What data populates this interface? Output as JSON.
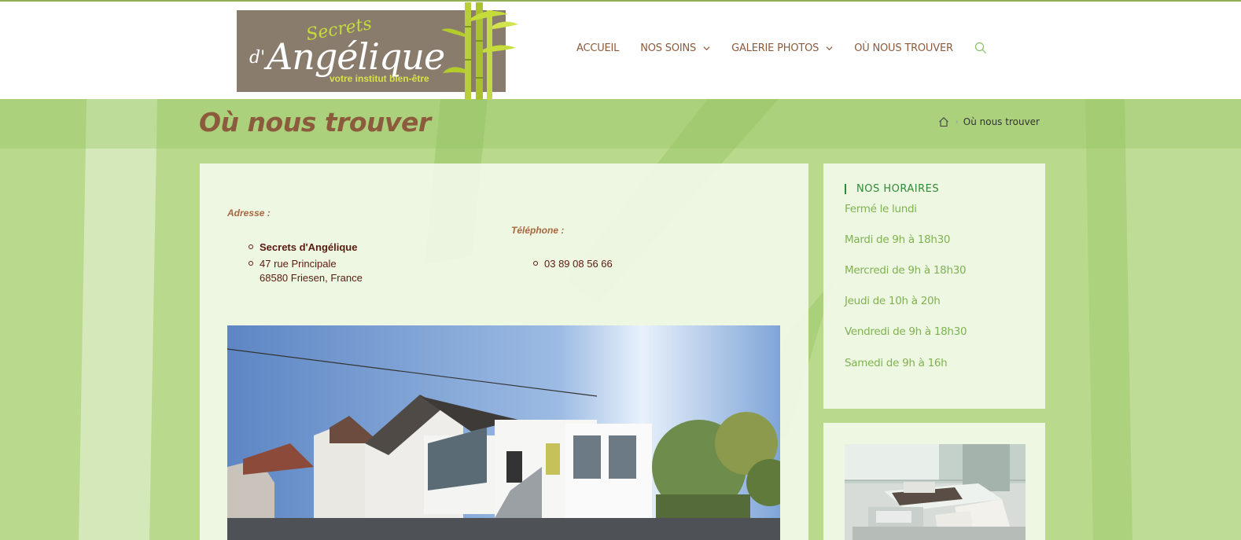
{
  "logo": {
    "line1": "Secrets",
    "line2_prefix": "d'",
    "line2": "Angélique",
    "tagline": "votre institut bien-être"
  },
  "nav": {
    "items": [
      {
        "label": "ACCUEIL",
        "has_dropdown": false
      },
      {
        "label": "NOS SOINS",
        "has_dropdown": true
      },
      {
        "label": "GALERIE PHOTOS",
        "has_dropdown": true
      },
      {
        "label": "OÙ NOUS TROUVER",
        "has_dropdown": false
      }
    ],
    "search_icon": "search-icon"
  },
  "page": {
    "title": "Où nous trouver",
    "breadcrumb": {
      "home_icon": "home-icon",
      "current": "Où nous trouver"
    }
  },
  "contact": {
    "address_label": "Adresse :",
    "address_lines": [
      "Secrets d'Angélique",
      "47 rue Principale",
      "68580 Friesen, France"
    ],
    "phone_label": "Téléphone :",
    "phone": "03 89 08 56 66"
  },
  "hours": {
    "title": "NOS HORAIRES",
    "items": [
      "Fermé le lundi",
      "Mardi de 9h à 18h30",
      "Mercredi de 9h à 18h30",
      "Jeudi de 10h à 20h",
      "Vendredi de 9h à 18h30",
      "Samedi de 9h à 16h"
    ]
  },
  "colors": {
    "brand_brown": "#8c5a3c",
    "accent_green": "#7fb251",
    "heading_green": "#2f8a36",
    "background_green": "#b9d98c",
    "logo_bg": "#8a7c6d"
  }
}
